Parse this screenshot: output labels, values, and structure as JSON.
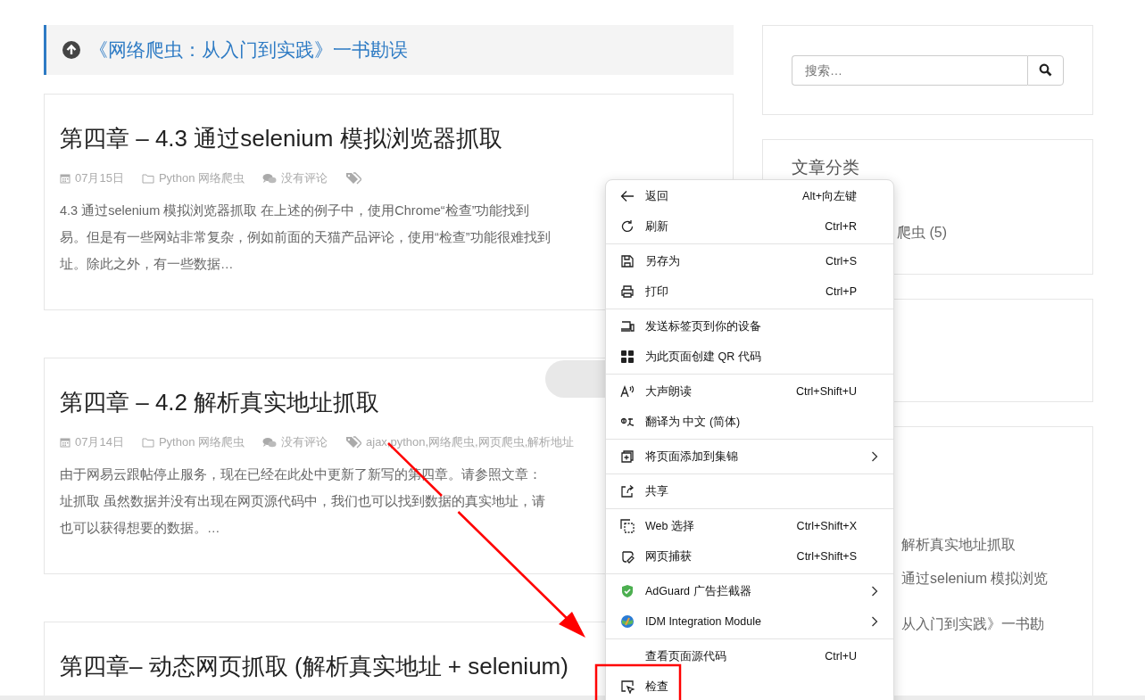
{
  "notice": {
    "title": "《网络爬虫：从入门到实践》一书勘误"
  },
  "posts": [
    {
      "title": "第四章 – 4.3 通过selenium 模拟浏览器抓取",
      "date": "07月15日",
      "category": "Python 网络爬虫",
      "comments": "没有评论",
      "excerpt": [
        "4.3 通过selenium 模拟浏览器抓取 在上述的例子中，使用Chrome“检查”功能找到",
        "易。但是有一些网站非常复杂，例如前面的天猫产品评论，使用“检查”功能很难找到",
        "址。除此之外，有一些数据…"
      ]
    },
    {
      "title": "第四章 – 4.2 解析真实地址抓取",
      "date": "07月14日",
      "category": "Python 网络爬虫",
      "comments": "没有评论",
      "tags": "ajax,python,网络爬虫,网页爬虫,解析地址",
      "excerpt": [
        "由于网易云跟帖停止服务，现在已经在此处中更新了新写的第四章。请参照文章：",
        "址抓取 虽然数据并没有出现在网页源代码中，我们也可以找到数据的真实地址，请",
        "也可以获得想要的数据。…"
      ]
    },
    {
      "title": "第四章– 动态网页抓取 (解析真实地址 + selenium)"
    }
  ],
  "sidebar": {
    "search": {
      "placeholder": "搜索…"
    },
    "categories": {
      "title": "文章分类",
      "items": [
        "爬虫 (5)"
      ]
    },
    "recent": [
      "解析真实地址抓取",
      "通过selenium 模拟浏览",
      "从入门到实践》一书勘"
    ]
  },
  "context_menu": {
    "sections": [
      {
        "items": [
          {
            "label": "返回",
            "shortcut": "Alt+向左键",
            "submenu": false
          },
          {
            "label": "刷新",
            "shortcut": "Ctrl+R",
            "submenu": false
          }
        ]
      },
      {
        "items": [
          {
            "label": "另存为",
            "shortcut": "Ctrl+S",
            "submenu": false
          },
          {
            "label": "打印",
            "shortcut": "Ctrl+P",
            "submenu": false
          }
        ]
      },
      {
        "items": [
          {
            "label": "发送标签页到你的设备",
            "submenu": false
          },
          {
            "label": "为此页面创建 QR 代码",
            "submenu": false
          }
        ]
      },
      {
        "items": [
          {
            "label": "大声朗读",
            "shortcut": "Ctrl+Shift+U",
            "submenu": false
          },
          {
            "label": "翻译为 中文 (简体)",
            "submenu": false
          }
        ]
      },
      {
        "items": [
          {
            "label": "将页面添加到集锦",
            "submenu": true
          }
        ]
      },
      {
        "items": [
          {
            "label": "共享",
            "submenu": false
          }
        ]
      },
      {
        "items": [
          {
            "label": "Web 选择",
            "shortcut": "Ctrl+Shift+X",
            "submenu": false
          },
          {
            "label": "网页捕获",
            "shortcut": "Ctrl+Shift+S",
            "submenu": false
          }
        ]
      },
      {
        "items": [
          {
            "label": "AdGuard 广告拦截器",
            "submenu": true
          },
          {
            "label": "IDM Integration Module",
            "submenu": true
          }
        ]
      },
      {
        "items": [
          {
            "label": "查看页面源代码",
            "shortcut": "Ctrl+U",
            "submenu": false
          },
          {
            "label": "检查",
            "submenu": false
          }
        ]
      }
    ]
  }
}
